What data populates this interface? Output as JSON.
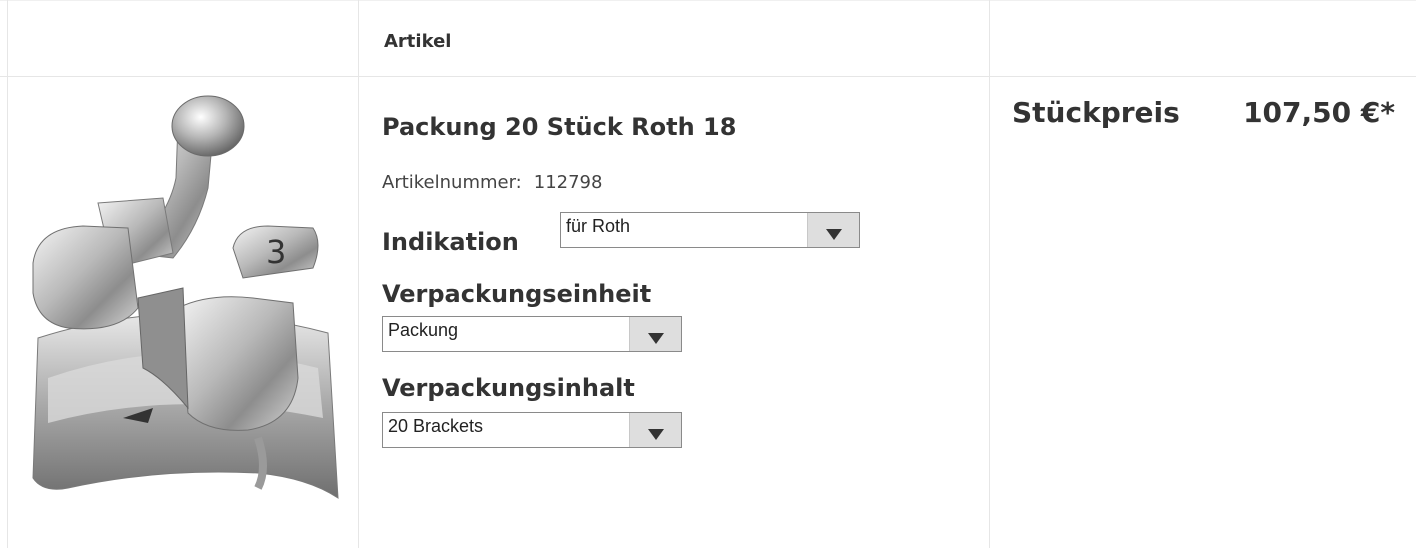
{
  "table": {
    "headers": {
      "article": "Artikel",
      "unit_price": "Stückpreis"
    }
  },
  "product": {
    "image_icon": "orthodontic-bracket-image",
    "title": "Packung 20 Stück Roth 18",
    "article_number_label": "Artikelnummer:",
    "article_number": "112798",
    "price": "107,50 €*",
    "options": {
      "indikation": {
        "label": "Indikation",
        "value": "für Roth"
      },
      "verpackungseinheit": {
        "label": "Verpackungseinheit",
        "value": "Packung"
      },
      "verpackungsinhalt": {
        "label": "Verpackungsinhalt",
        "value": "20 Brackets"
      }
    }
  },
  "colors": {
    "text": "#333333",
    "border": "#e6e6e6",
    "select_button": "#dedede"
  }
}
